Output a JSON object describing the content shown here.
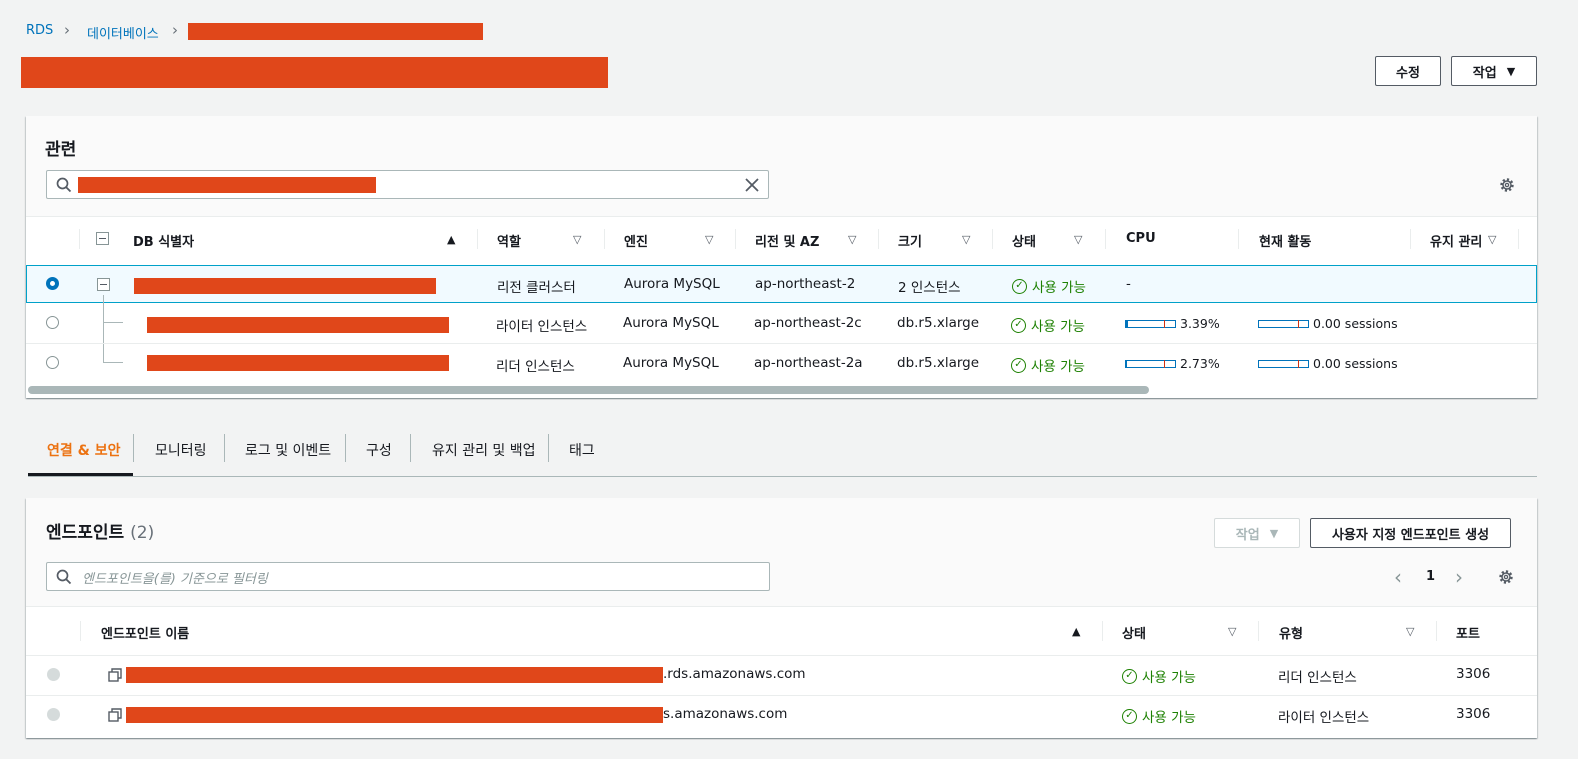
{
  "breadcrumb": {
    "root": "RDS",
    "databases": "데이터베이스"
  },
  "header": {
    "modify_label": "수정",
    "actions_label": "작업"
  },
  "related": {
    "title": "관련",
    "columns": {
      "db_id": "DB 식별자",
      "role": "역할",
      "engine": "엔진",
      "region_az": "리전 및 AZ",
      "size": "크기",
      "status": "상태",
      "cpu": "CPU",
      "activity": "현재 활동",
      "maintenance": "유지 관리"
    },
    "rows": [
      {
        "role": "리전 클러스터",
        "engine": "Aurora MySQL",
        "az": "ap-northeast-2",
        "size": "2 인스턴스",
        "status": "사용 가능",
        "cpu": "-",
        "activity": "",
        "cpu_pct": 0,
        "selected": true
      },
      {
        "role": "라이터 인스턴스",
        "engine": "Aurora MySQL",
        "az": "ap-northeast-2c",
        "size": "db.r5.xlarge",
        "status": "사용 가능",
        "cpu": "3.39%",
        "activity": "0.00 sessions",
        "cpu_pct": 3.39,
        "selected": false
      },
      {
        "role": "리더 인스턴스",
        "engine": "Aurora MySQL",
        "az": "ap-northeast-2a",
        "size": "db.r5.xlarge",
        "status": "사용 가능",
        "cpu": "2.73%",
        "activity": "0.00 sessions",
        "cpu_pct": 2.73,
        "selected": false
      }
    ]
  },
  "tabs": [
    {
      "label": "연결 & 보안",
      "active": true
    },
    {
      "label": "모니터링",
      "active": false
    },
    {
      "label": "로그 및 이벤트",
      "active": false
    },
    {
      "label": "구성",
      "active": false
    },
    {
      "label": "유지 관리 및 백업",
      "active": false
    },
    {
      "label": "태그",
      "active": false
    }
  ],
  "endpoints": {
    "title": "엔드포인트",
    "count": "(2)",
    "actions_label": "작업",
    "create_label": "사용자 지정 엔드포인트 생성",
    "filter_placeholder": "엔드포인트을(를) 기준으로 필터링",
    "page": "1",
    "columns": {
      "name": "엔드포인트 이름",
      "status": "상태",
      "type": "유형",
      "port": "포트"
    },
    "rows": [
      {
        "name_suffix": ".rds.amazonaws.com",
        "status": "사용 가능",
        "type": "리더 인스턴스",
        "port": "3306"
      },
      {
        "name_suffix": "s.amazonaws.com",
        "status": "사용 가능",
        "type": "라이터 인스턴스",
        "port": "3306"
      }
    ]
  },
  "colors": {
    "redaction": "#e0471a",
    "link": "#0073bb",
    "active_tab": "#ec7211",
    "available": "#1d8102"
  }
}
